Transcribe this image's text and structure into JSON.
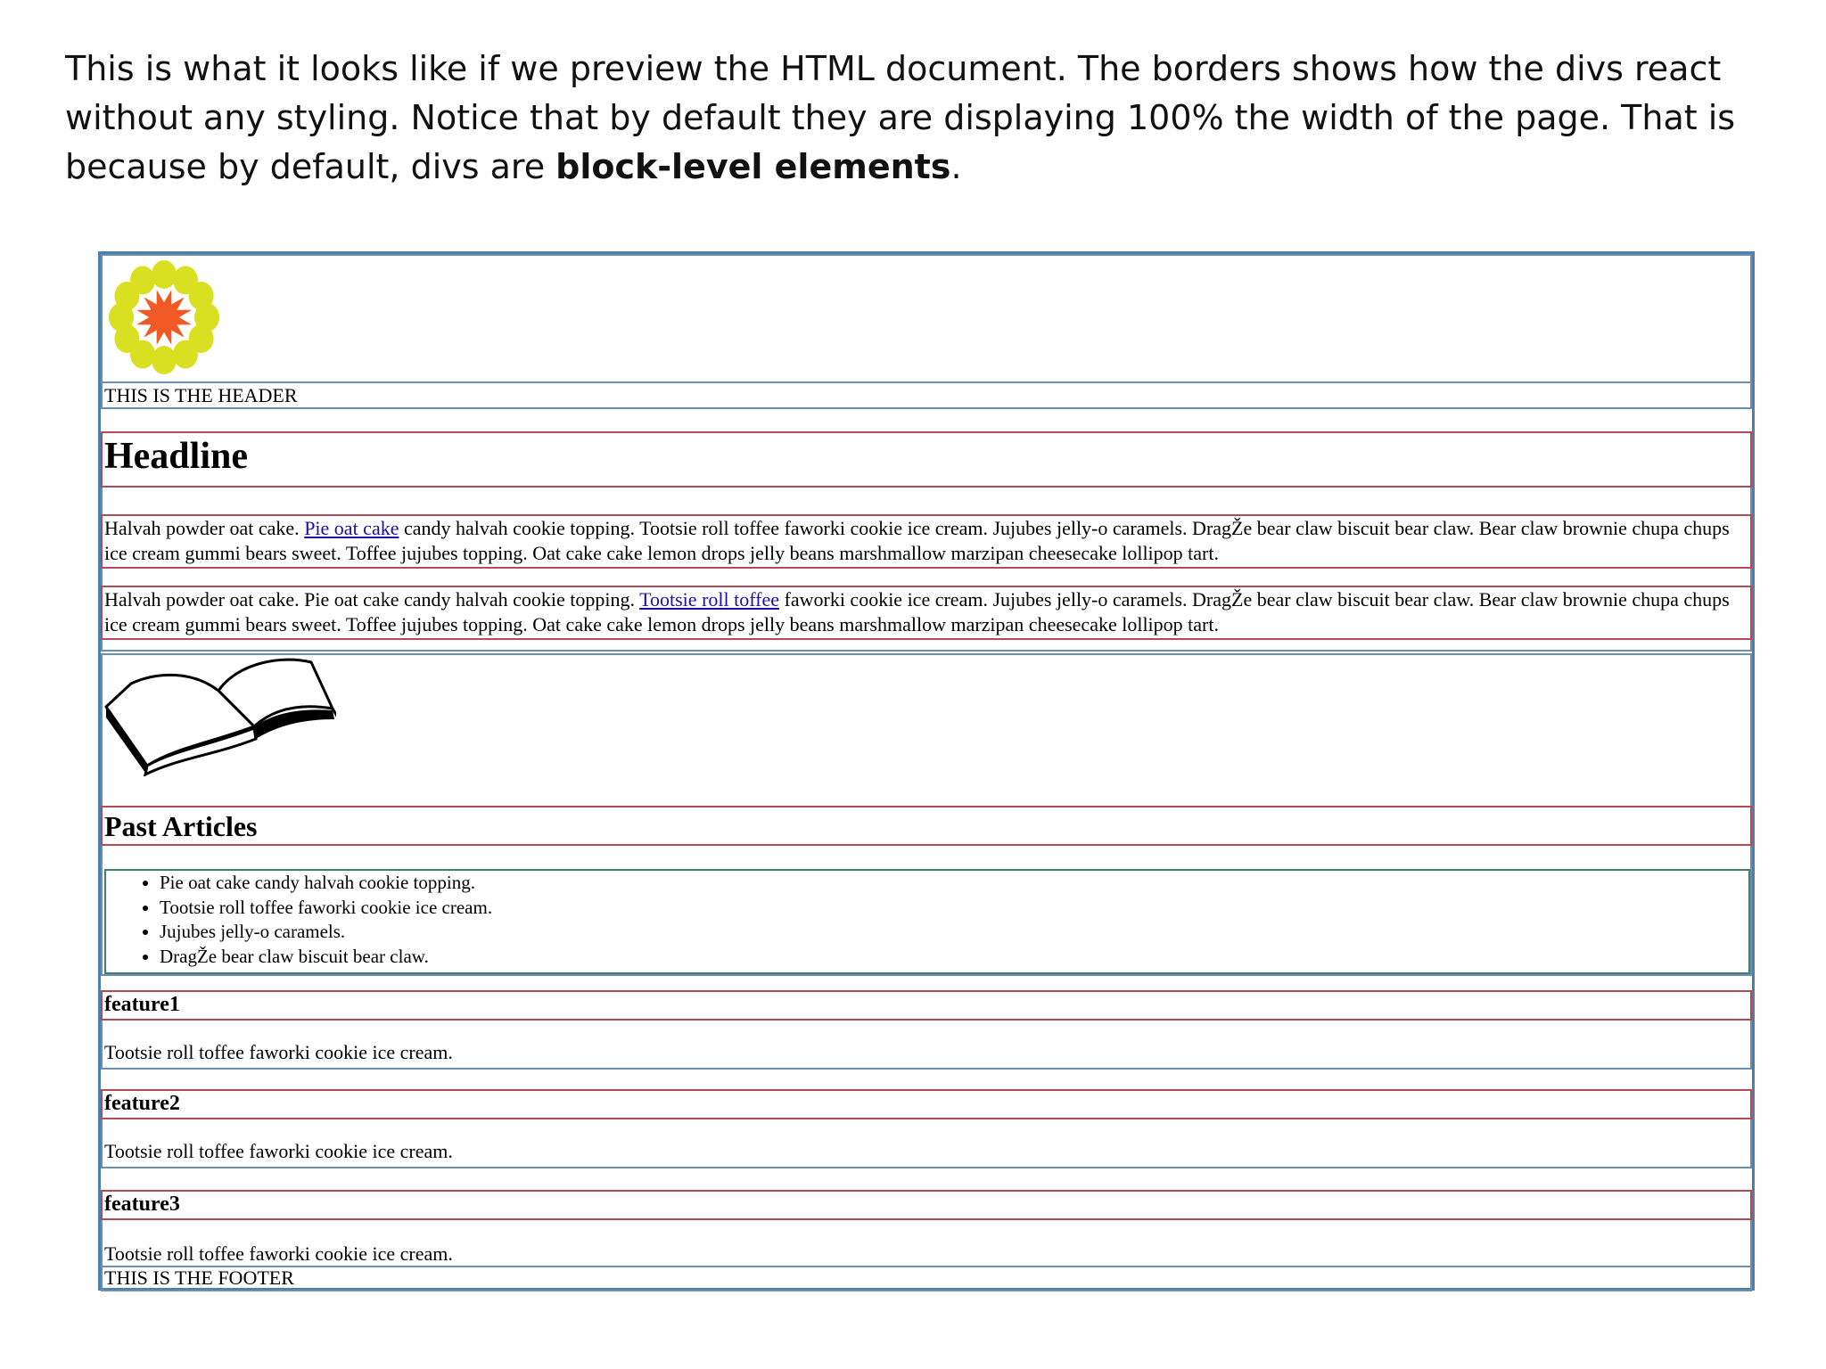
{
  "caption": {
    "text_part1": "This is what it looks like if we preview the HTML document. The borders shows how the divs react without any styling. Notice that by default they are displaying 100% the width of the page. That is because by default, divs are ",
    "bold_text": "block-level elements",
    "text_part2": "."
  },
  "header": {
    "logo_icon": "flower-logo-icon",
    "text": "THIS IS THE HEADER"
  },
  "headline": "Headline",
  "paragraphs": [
    {
      "pre": "Halvah powder oat cake. ",
      "link": "Pie oat cake",
      "post": " candy halvah cookie topping. Tootsie roll toffee faworki cookie ice cream. Jujubes jelly-o caramels. DragŽe bear claw biscuit bear claw. Bear claw brownie chupa chups ice cream gummi bears sweet. Toffee jujubes topping. Oat cake cake lemon drops jelly beans marshmallow marzipan cheesecake lollipop tart."
    },
    {
      "pre": "Halvah powder oat cake. Pie oat cake candy halvah cookie topping. ",
      "link": "Tootsie roll toffee",
      "post": " faworki cookie ice cream. Jujubes jelly-o caramels. DragŽe bear claw biscuit bear claw. Bear claw brownie chupa chups ice cream gummi bears sweet. Toffee jujubes topping. Oat cake cake lemon drops jelly beans marshmallow marzipan cheesecake lollipop tart."
    }
  ],
  "sidebar": {
    "image_icon": "open-book-icon",
    "title": "Past Articles",
    "items": [
      "Pie oat cake candy halvah cookie topping.",
      "Tootsie roll toffee faworki cookie ice cream.",
      "Jujubes jelly-o caramels.",
      "DragŽe bear claw biscuit bear claw."
    ]
  },
  "features": [
    {
      "title": "feature1",
      "text": "Tootsie roll toffee faworki cookie ice cream."
    },
    {
      "title": "feature2",
      "text": "Tootsie roll toffee faworki cookie ice cream."
    },
    {
      "title": "feature3",
      "text": "Tootsie roll toffee faworki cookie ice cream."
    }
  ],
  "footer": {
    "text": "THIS IS THE FOOTER"
  },
  "colors": {
    "outer_border": "#4d7fa8",
    "div_border_blue": "#6b8fb0",
    "heading_border_red": "#b34a5a",
    "list_border_green": "#3e7f6f",
    "link": "#1a0dab",
    "logo_petal": "#d9e021",
    "logo_center": "#f15a24"
  }
}
